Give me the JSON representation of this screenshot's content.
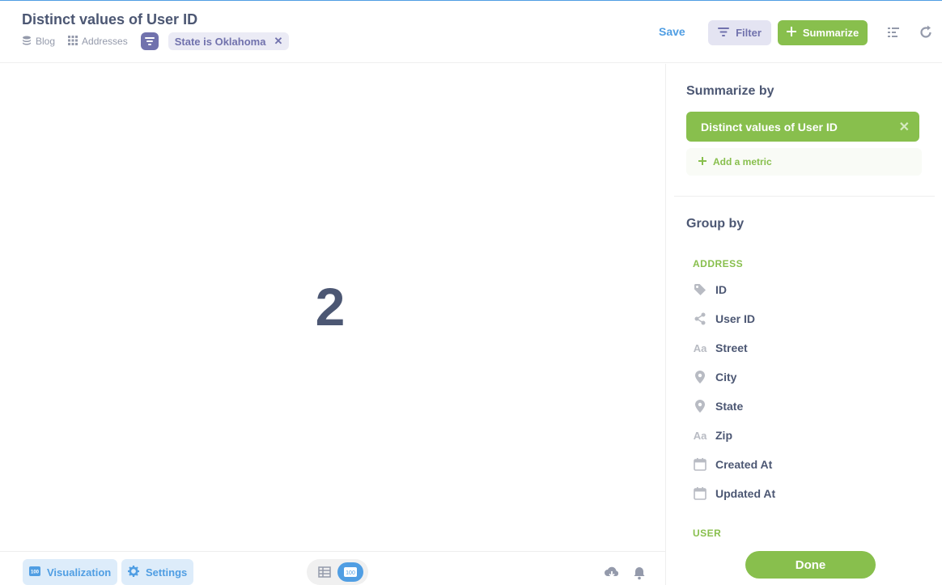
{
  "header": {
    "title": "Distinct values of User ID",
    "breadcrumbs": [
      {
        "label": "Blog",
        "icon": "database-icon"
      },
      {
        "label": "Addresses",
        "icon": "grid-icon"
      }
    ],
    "filter_pill": "State is Oklahoma",
    "save_label": "Save",
    "filter_label": "Filter",
    "summarize_label": "Summarize",
    "colors": {
      "accent": "#509ee3",
      "filter": "#7172ad",
      "summarize": "#88bf4d"
    }
  },
  "main": {
    "value": "2"
  },
  "footer": {
    "visualization_label": "Visualization",
    "settings_label": "Settings",
    "toggle_active": "number",
    "number_badge": "100"
  },
  "sidebar": {
    "summarize_title": "Summarize by",
    "metric": "Distinct values of User ID",
    "add_metric": "Add a metric",
    "group_title": "Group by",
    "groups": [
      {
        "label": "ADDRESS",
        "fields": [
          {
            "label": "ID",
            "icon": "tag-icon"
          },
          {
            "label": "User ID",
            "icon": "connections-icon"
          },
          {
            "label": "Street",
            "icon": "text-icon"
          },
          {
            "label": "City",
            "icon": "location-icon"
          },
          {
            "label": "State",
            "icon": "location-icon"
          },
          {
            "label": "Zip",
            "icon": "text-icon"
          },
          {
            "label": "Created At",
            "icon": "calendar-icon"
          },
          {
            "label": "Updated At",
            "icon": "calendar-icon"
          }
        ]
      },
      {
        "label": "USER",
        "fields": []
      }
    ],
    "done_label": "Done"
  }
}
